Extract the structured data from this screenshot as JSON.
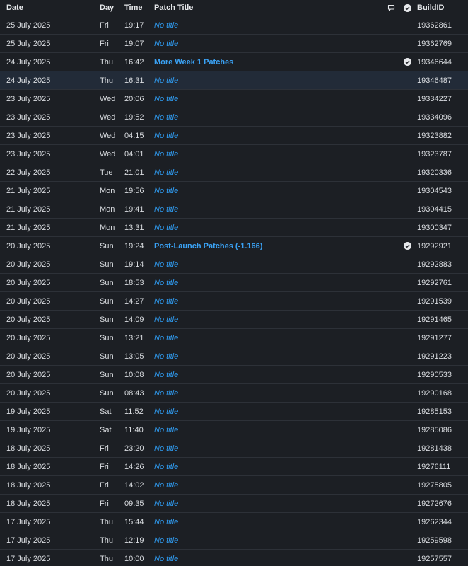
{
  "header": {
    "date": "Date",
    "day": "Day",
    "time": "Time",
    "title": "Patch Title",
    "build": "BuildID"
  },
  "colors": {
    "link": "#3aa2f5",
    "no_title": "#2f9bf0",
    "highlight": "#222b38"
  },
  "icons": {
    "comment": "comment-icon",
    "verified": "check-circle-icon"
  },
  "rows": [
    {
      "date": "25 July 2025",
      "day": "Fri",
      "time": "19:17",
      "title": "No title",
      "titled": false,
      "verified": false,
      "build": "19362861",
      "highlight": false
    },
    {
      "date": "25 July 2025",
      "day": "Fri",
      "time": "19:07",
      "title": "No title",
      "titled": false,
      "verified": false,
      "build": "19362769",
      "highlight": false
    },
    {
      "date": "24 July 2025",
      "day": "Thu",
      "time": "16:42",
      "title": "More Week 1 Patches",
      "titled": true,
      "verified": true,
      "build": "19346644",
      "highlight": false
    },
    {
      "date": "24 July 2025",
      "day": "Thu",
      "time": "16:31",
      "title": "No title",
      "titled": false,
      "verified": false,
      "build": "19346487",
      "highlight": true
    },
    {
      "date": "23 July 2025",
      "day": "Wed",
      "time": "20:06",
      "title": "No title",
      "titled": false,
      "verified": false,
      "build": "19334227",
      "highlight": false
    },
    {
      "date": "23 July 2025",
      "day": "Wed",
      "time": "19:52",
      "title": "No title",
      "titled": false,
      "verified": false,
      "build": "19334096",
      "highlight": false
    },
    {
      "date": "23 July 2025",
      "day": "Wed",
      "time": "04:15",
      "title": "No title",
      "titled": false,
      "verified": false,
      "build": "19323882",
      "highlight": false
    },
    {
      "date": "23 July 2025",
      "day": "Wed",
      "time": "04:01",
      "title": "No title",
      "titled": false,
      "verified": false,
      "build": "19323787",
      "highlight": false
    },
    {
      "date": "22 July 2025",
      "day": "Tue",
      "time": "21:01",
      "title": "No title",
      "titled": false,
      "verified": false,
      "build": "19320336",
      "highlight": false
    },
    {
      "date": "21 July 2025",
      "day": "Mon",
      "time": "19:56",
      "title": "No title",
      "titled": false,
      "verified": false,
      "build": "19304543",
      "highlight": false
    },
    {
      "date": "21 July 2025",
      "day": "Mon",
      "time": "19:41",
      "title": "No title",
      "titled": false,
      "verified": false,
      "build": "19304415",
      "highlight": false
    },
    {
      "date": "21 July 2025",
      "day": "Mon",
      "time": "13:31",
      "title": "No title",
      "titled": false,
      "verified": false,
      "build": "19300347",
      "highlight": false
    },
    {
      "date": "20 July 2025",
      "day": "Sun",
      "time": "19:24",
      "title": "Post-Launch Patches (-1.166)",
      "titled": true,
      "verified": true,
      "build": "19292921",
      "highlight": false
    },
    {
      "date": "20 July 2025",
      "day": "Sun",
      "time": "19:14",
      "title": "No title",
      "titled": false,
      "verified": false,
      "build": "19292883",
      "highlight": false
    },
    {
      "date": "20 July 2025",
      "day": "Sun",
      "time": "18:53",
      "title": "No title",
      "titled": false,
      "verified": false,
      "build": "19292761",
      "highlight": false
    },
    {
      "date": "20 July 2025",
      "day": "Sun",
      "time": "14:27",
      "title": "No title",
      "titled": false,
      "verified": false,
      "build": "19291539",
      "highlight": false
    },
    {
      "date": "20 July 2025",
      "day": "Sun",
      "time": "14:09",
      "title": "No title",
      "titled": false,
      "verified": false,
      "build": "19291465",
      "highlight": false
    },
    {
      "date": "20 July 2025",
      "day": "Sun",
      "time": "13:21",
      "title": "No title",
      "titled": false,
      "verified": false,
      "build": "19291277",
      "highlight": false
    },
    {
      "date": "20 July 2025",
      "day": "Sun",
      "time": "13:05",
      "title": "No title",
      "titled": false,
      "verified": false,
      "build": "19291223",
      "highlight": false
    },
    {
      "date": "20 July 2025",
      "day": "Sun",
      "time": "10:08",
      "title": "No title",
      "titled": false,
      "verified": false,
      "build": "19290533",
      "highlight": false
    },
    {
      "date": "20 July 2025",
      "day": "Sun",
      "time": "08:43",
      "title": "No title",
      "titled": false,
      "verified": false,
      "build": "19290168",
      "highlight": false
    },
    {
      "date": "19 July 2025",
      "day": "Sat",
      "time": "11:52",
      "title": "No title",
      "titled": false,
      "verified": false,
      "build": "19285153",
      "highlight": false
    },
    {
      "date": "19 July 2025",
      "day": "Sat",
      "time": "11:40",
      "title": "No title",
      "titled": false,
      "verified": false,
      "build": "19285086",
      "highlight": false
    },
    {
      "date": "18 July 2025",
      "day": "Fri",
      "time": "23:20",
      "title": "No title",
      "titled": false,
      "verified": false,
      "build": "19281438",
      "highlight": false
    },
    {
      "date": "18 July 2025",
      "day": "Fri",
      "time": "14:26",
      "title": "No title",
      "titled": false,
      "verified": false,
      "build": "19276111",
      "highlight": false
    },
    {
      "date": "18 July 2025",
      "day": "Fri",
      "time": "14:02",
      "title": "No title",
      "titled": false,
      "verified": false,
      "build": "19275805",
      "highlight": false
    },
    {
      "date": "18 July 2025",
      "day": "Fri",
      "time": "09:35",
      "title": "No title",
      "titled": false,
      "verified": false,
      "build": "19272676",
      "highlight": false
    },
    {
      "date": "17 July 2025",
      "day": "Thu",
      "time": "15:44",
      "title": "No title",
      "titled": false,
      "verified": false,
      "build": "19262344",
      "highlight": false
    },
    {
      "date": "17 July 2025",
      "day": "Thu",
      "time": "12:19",
      "title": "No title",
      "titled": false,
      "verified": false,
      "build": "19259598",
      "highlight": false
    },
    {
      "date": "17 July 2025",
      "day": "Thu",
      "time": "10:00",
      "title": "No title",
      "titled": false,
      "verified": false,
      "build": "19257557",
      "highlight": false
    }
  ]
}
